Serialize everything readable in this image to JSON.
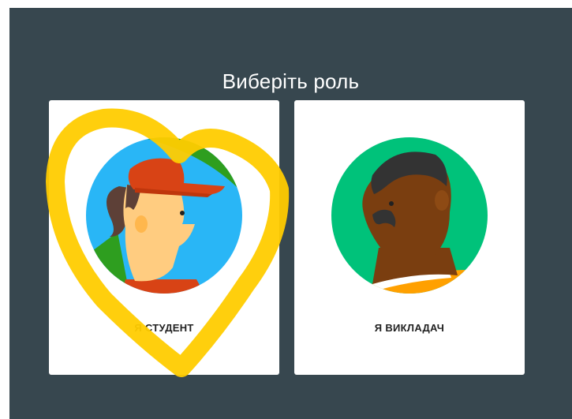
{
  "title": "Виберіть роль",
  "roles": [
    {
      "label": "Я СТУДЕНТ"
    },
    {
      "label": "Я ВИКЛАДАЧ"
    }
  ],
  "colors": {
    "background": "#37474f",
    "card": "#ffffff",
    "annotation": "#ffcc00"
  }
}
